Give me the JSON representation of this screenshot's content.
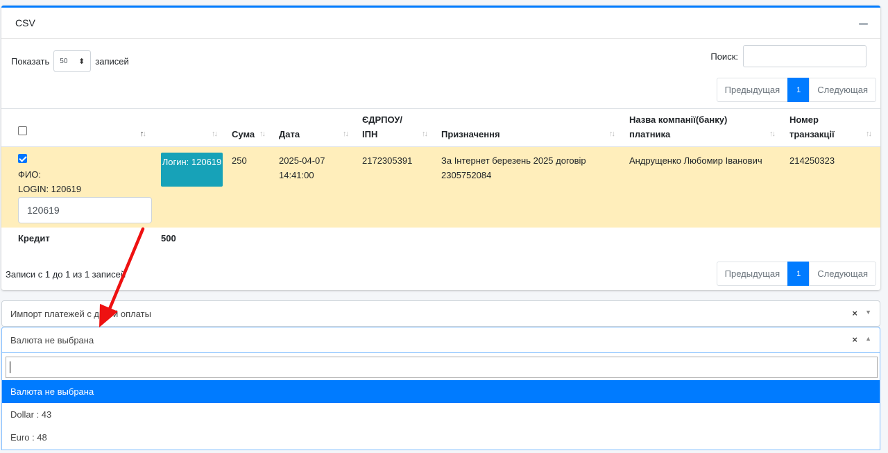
{
  "card": {
    "title": "CSV"
  },
  "length": {
    "prefix": "Показать",
    "value": "50",
    "suffix": "записей"
  },
  "search": {
    "label": "Поиск:",
    "value": ""
  },
  "pagination": {
    "prev": "Предыдущая",
    "page": "1",
    "next": "Следующая"
  },
  "table": {
    "headers": [
      "",
      "",
      "Сума",
      "Дата",
      "ЄДРПОУ/ ІПН",
      "Призначення",
      "Назва компанії(банку) платника",
      "Номер транзакції"
    ],
    "row": {
      "checked": true,
      "fio_label": "ФИО:",
      "login_label": "LOGIN: 120619",
      "login_input": "120619",
      "login_button": "Логин: 120619",
      "sum": "250",
      "date": "2025-04-07 14:41:00",
      "edrpou": "2172305391",
      "purpose": "За Інтернет березень 2025 договір 2305752084",
      "company": "Андрущенко Любомир Іванович",
      "transaction": "214250323"
    },
    "footer": {
      "label": "Кредит",
      "total": "500"
    },
    "info": "Записи с 1 до 1 из 1 записей"
  },
  "select_import": {
    "value": "Импорт платежей с датой оплаты",
    "clear": "×"
  },
  "select_currency": {
    "value": "Валюта не выбрана",
    "clear": "×",
    "search_value": "",
    "options": [
      "Валюта не выбрана",
      "Dollar : 43",
      "Euro : 48"
    ]
  },
  "colors": {
    "accent": "#007bff",
    "highlight_row": "#ffeebb",
    "button": "#17a2b8",
    "arrow": "#ee1111"
  }
}
